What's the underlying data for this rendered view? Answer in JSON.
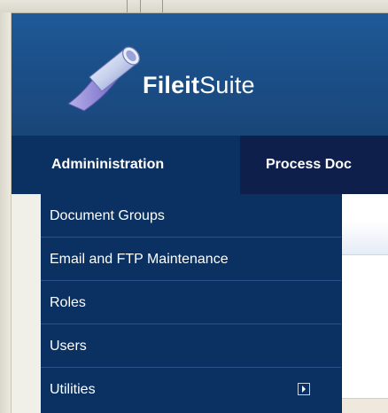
{
  "app": {
    "brand_bold": "Fileit",
    "brand_light": "Suite",
    "logo_icon": "folder-pipe-icon"
  },
  "nav": {
    "tabs": [
      {
        "label": "Admininistration",
        "active": true
      },
      {
        "label": "Process Doc",
        "active": false
      }
    ]
  },
  "menu": {
    "items": [
      {
        "label": "Document Groups",
        "has_submenu": false
      },
      {
        "label": "Email and FTP Maintenance",
        "has_submenu": false
      },
      {
        "label": "Roles",
        "has_submenu": false
      },
      {
        "label": "Users",
        "has_submenu": false
      },
      {
        "label": "Utilities",
        "has_submenu": true,
        "submenu_icon": "chevron-right-icon"
      }
    ]
  },
  "colors": {
    "header_blue": "#1b4f88",
    "nav_dark": "#0d1f4a",
    "menu_blue": "#0a3161",
    "text": "#ffffff"
  }
}
